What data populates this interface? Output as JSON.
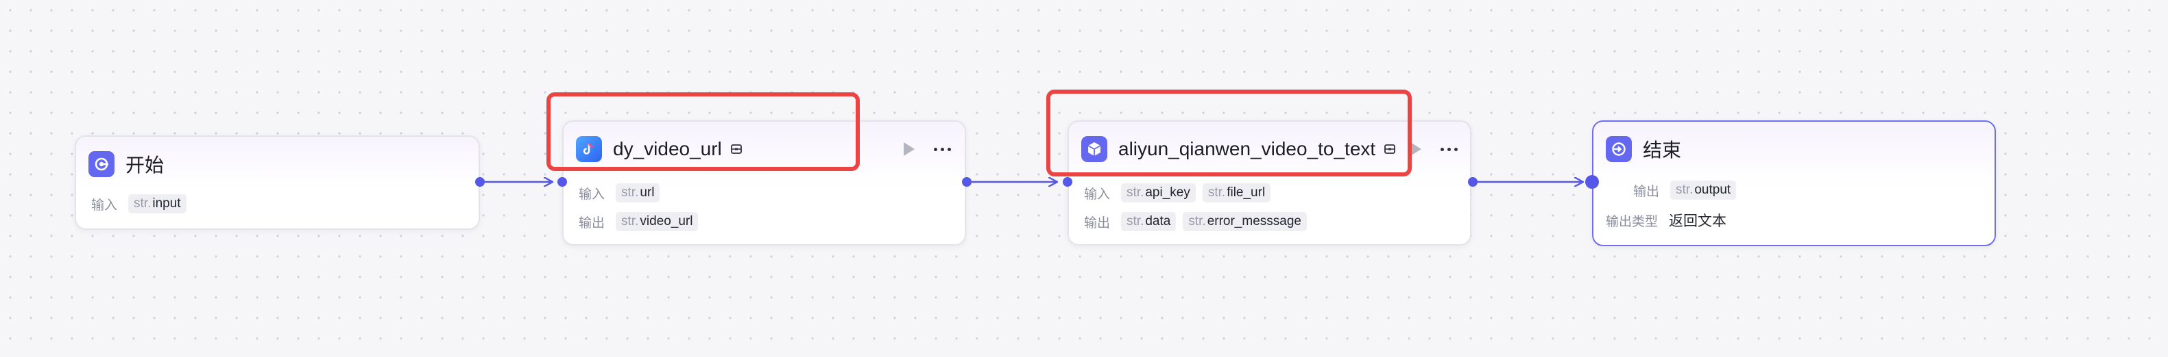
{
  "nodes": {
    "start": {
      "title": "开始",
      "input_label": "输入",
      "params": [
        {
          "type": "str.",
          "name": "input"
        }
      ]
    },
    "dy": {
      "title": "dy_video_url",
      "input_label": "输入",
      "inputs": [
        {
          "type": "str.",
          "name": "url"
        }
      ],
      "output_label": "输出",
      "outputs": [
        {
          "type": "str.",
          "name": "video_url"
        }
      ]
    },
    "aliyun": {
      "title": "aliyun_qianwen_video_to_text",
      "input_label": "输入",
      "inputs": [
        {
          "type": "str.",
          "name": "api_key"
        },
        {
          "type": "str.",
          "name": "file_url"
        }
      ],
      "output_label": "输出",
      "outputs": [
        {
          "type": "str.",
          "name": "data"
        },
        {
          "type": "str.",
          "name": "error_messsage"
        }
      ]
    },
    "end": {
      "title": "结束",
      "output_label": "输出",
      "outputs": [
        {
          "type": "str.",
          "name": "output"
        }
      ],
      "output_type_label": "输出类型",
      "output_type_value": "返回文本"
    }
  },
  "colors": {
    "accent": "#5457e8",
    "highlight": "#ec4343",
    "node_border": "#e3e3ea"
  },
  "icons": [
    "start-icon",
    "douyin-icon",
    "plugin-cube-icon",
    "end-icon",
    "plugin-badge-icon",
    "play-icon",
    "more-icon"
  ]
}
